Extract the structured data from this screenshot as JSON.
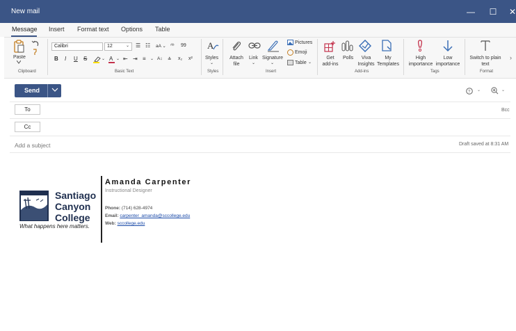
{
  "window": {
    "title": "New mail",
    "minimize": "—",
    "maximize": "☐",
    "close": "✕"
  },
  "tabs": [
    {
      "label": "Message",
      "active": true
    },
    {
      "label": "Insert"
    },
    {
      "label": "Format text"
    },
    {
      "label": "Options"
    },
    {
      "label": "Table"
    }
  ],
  "ribbon": {
    "clipboard": {
      "paste": "Paste",
      "group": "Clipboard"
    },
    "basic_text": {
      "font": "Calibri",
      "size": "12",
      "group": "Basic Text"
    },
    "styles": {
      "label": "Styles",
      "group": "Styles"
    },
    "insert": {
      "attach": "Attach file",
      "link": "Link",
      "signature": "Signature",
      "pictures": "Pictures",
      "emoji": "Emoji",
      "table": "Table",
      "group": "Insert"
    },
    "addins": {
      "get": "Get add-ins",
      "polls": "Polls",
      "viva": "Viva Insights",
      "templates": "My Templates",
      "group": "Add-ins"
    },
    "tags": {
      "high": "High importance",
      "low": "Low importance",
      "group": "Tags"
    },
    "format": {
      "plain": "Switch to plain text",
      "group": "Format"
    }
  },
  "compose": {
    "send": "Send",
    "to": "To",
    "cc": "Cc",
    "bcc": "Bcc",
    "subject_placeholder": "Add a subject",
    "draft_status": "Draft saved at 8:31 AM"
  },
  "signature": {
    "name": "Amanda Carpenter",
    "role": "Instructional Designer",
    "phone_label": "Phone:",
    "phone": "(714) 628-4974",
    "email_label": "Email:",
    "email": "carpenter_amanda@sccollege.edu",
    "web_label": "Web:",
    "web": "sccollege.edu",
    "logo_line1": "Santiago",
    "logo_line2": "Canyon",
    "logo_line3": "College",
    "tagline": "What happens here matters."
  },
  "colors": {
    "accent": "#3b5586",
    "ribbon_icon": "#3b6fb6",
    "flag": "#c4314b"
  }
}
